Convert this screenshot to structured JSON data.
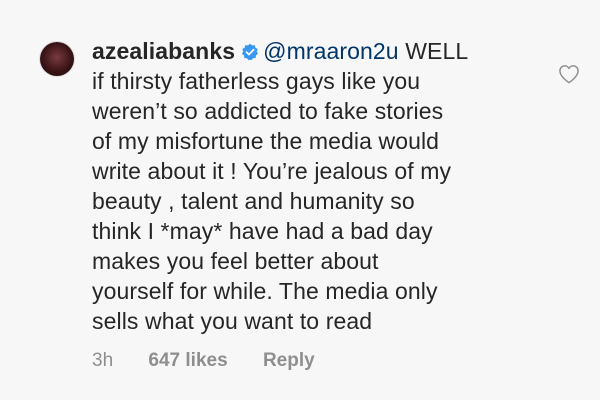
{
  "comment": {
    "username": "azealiabanks",
    "verified_icon": "verified-badge-icon",
    "mention": "@mraaron2u",
    "lines": [
      " WELL",
      "if thirsty fatherless gays like you",
      "weren’t so addicted to fake stories",
      "of my misfortune the media would",
      "write about it ! You’re jealous of my",
      "beauty , talent and humanity so",
      "think I *may* have had a bad day",
      "makes you feel better about",
      "yourself for while. The media only",
      "sells what you want to read"
    ],
    "like_icon": "heart-outline-icon",
    "time": "3h",
    "likes": "647 likes",
    "reply": "Reply"
  },
  "colors": {
    "background": "#f7f7f7",
    "text": "#262626",
    "meta": "#8e8e8e",
    "verified": "#3897f0"
  }
}
